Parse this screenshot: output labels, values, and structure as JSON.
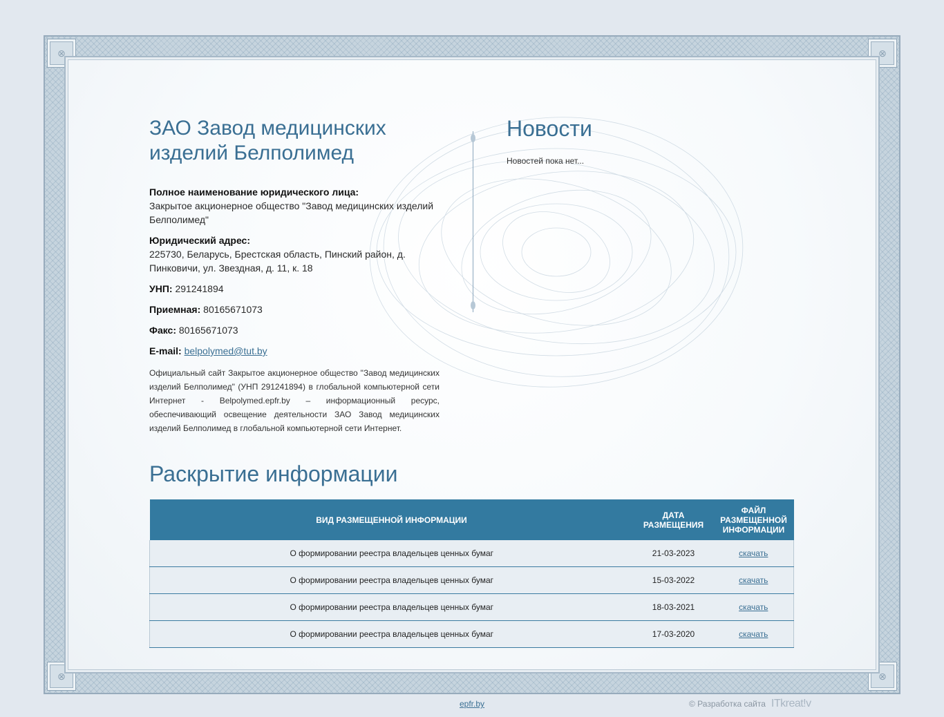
{
  "company": {
    "title": "ЗАО Завод медицинских изделий Белполимед",
    "full_name_label": "Полное наименование юридического лица:",
    "full_name": "Закрытое акционерное общество \"Завод медицинских изделий Белполимед\"",
    "address_label": "Юридический адрес:",
    "address": "225730, Беларусь, Брестская область, Пинский район, д. Пинковичи, ул. Звездная, д. 11, к. 18",
    "unp_label": "УНП:",
    "unp": "291241894",
    "reception_label": "Приемная:",
    "reception": "80165671073",
    "fax_label": "Факс:",
    "fax": "80165671073",
    "email_label": "E-mail:",
    "email": "belpolymed@tut.by",
    "about": "Официальный сайт Закрытое акционерное общество \"Завод медицинских изделий Белполимед\" (УНП 291241894) в глобальной компьютерной сети Интернет - Belpolymed.epfr.by – информационный ресурс, обеспечивающий освещение деятельности ЗАО Завод медицинских изделий Белполимед в глобальной компьютерной сети Интернет."
  },
  "news": {
    "title": "Новости",
    "empty": "Новостей пока нет..."
  },
  "disclosure": {
    "title": "Раскрытие информации",
    "headers": [
      "Вид размещенной информации",
      "Дата размещения",
      "Файл размещенной информации"
    ],
    "rows": [
      {
        "type": "О формировании реестра владельцев ценных бумаг",
        "date": "21-03-2023",
        "file": "скачать"
      },
      {
        "type": "О формировании реестра владельцев ценных бумаг",
        "date": "15-03-2022",
        "file": "скачать"
      },
      {
        "type": "О формировании реестра владельцев ценных бумаг",
        "date": "18-03-2021",
        "file": "скачать"
      },
      {
        "type": "О формировании реестра владельцев ценных бумаг",
        "date": "17-03-2020",
        "file": "скачать"
      }
    ]
  },
  "footer": {
    "link": "epfr.by",
    "developer_text": "© Разработка сайта",
    "developer_logo": "ITkreat!v"
  },
  "colors": {
    "accent": "#3a6f93",
    "table_header": "#337aa0",
    "background": "#e2e8ef"
  }
}
